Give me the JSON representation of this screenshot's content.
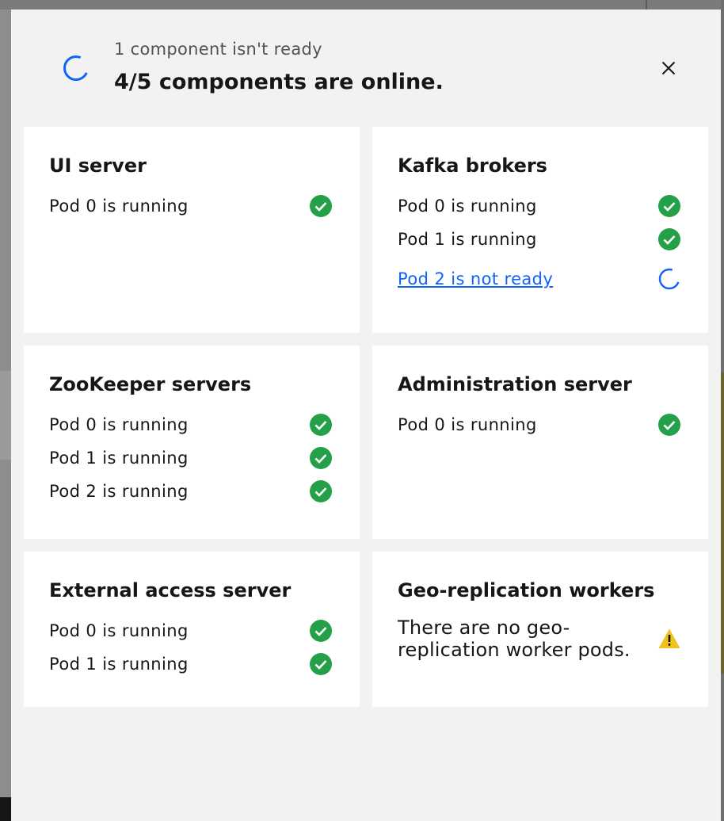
{
  "header": {
    "subtitle": "1 component isn't ready",
    "title": "4/5 components are online."
  },
  "colors": {
    "ok": "#24a148",
    "pending": "#0f62fe",
    "warning": "#f1c21b"
  },
  "cards": [
    {
      "title": "UI server",
      "pods": [
        {
          "label": "Pod 0 is running",
          "status": "checkmark-icon"
        }
      ]
    },
    {
      "title": "Kafka brokers",
      "pods": [
        {
          "label": "Pod 0 is running",
          "status": "checkmark-icon"
        },
        {
          "label": "Pod 1 is running",
          "status": "checkmark-icon"
        },
        {
          "label": "Pod 2 is not ready",
          "status": "loading-spinner-icon"
        }
      ]
    },
    {
      "title": "ZooKeeper servers",
      "pods": [
        {
          "label": "Pod 0 is running",
          "status": "checkmark-icon"
        },
        {
          "label": "Pod 1 is running",
          "status": "checkmark-icon"
        },
        {
          "label": "Pod 2 is running",
          "status": "checkmark-icon"
        }
      ]
    },
    {
      "title": "Administration server",
      "pods": [
        {
          "label": "Pod 0 is running",
          "status": "checkmark-icon"
        }
      ]
    },
    {
      "title": "External access server",
      "pods": [
        {
          "label": "Pod 0 is running",
          "status": "checkmark-icon"
        },
        {
          "label": "Pod 1 is running",
          "status": "checkmark-icon"
        }
      ]
    },
    {
      "title": "Geo-replication workers",
      "message": "There are no geo-replication worker pods.",
      "status": "warning-icon"
    }
  ]
}
